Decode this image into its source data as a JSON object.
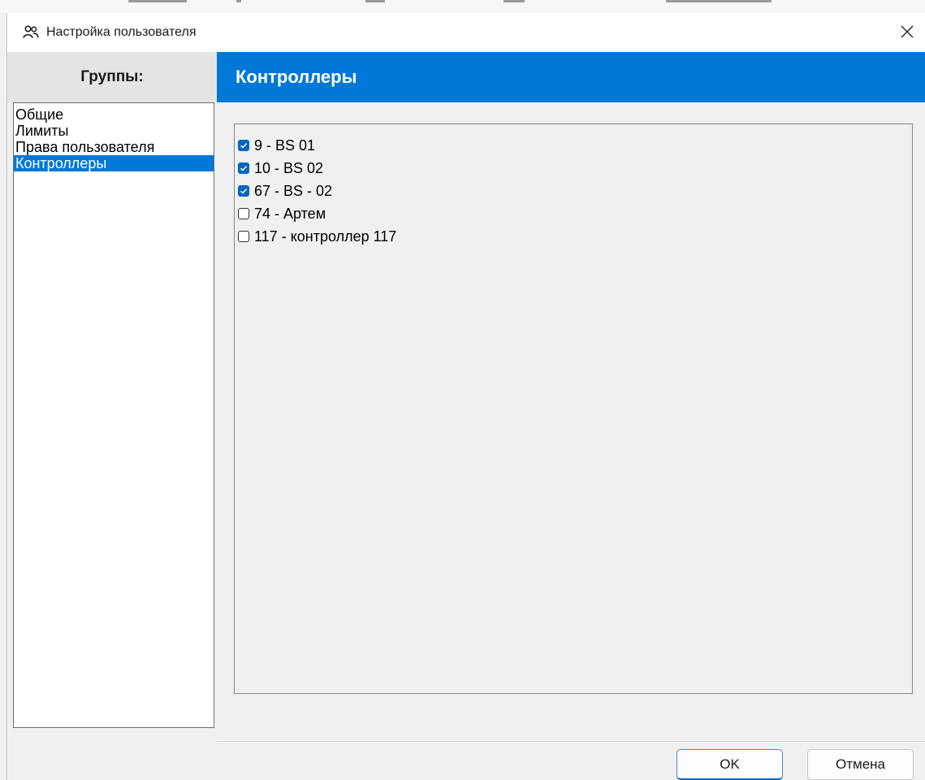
{
  "window": {
    "title": "Настройка пользователя",
    "title_icon": "users-icon",
    "close_icon": "close-icon"
  },
  "groups": {
    "header": "Группы:",
    "items": [
      {
        "label": "Общие",
        "selected": false
      },
      {
        "label": "Лимиты",
        "selected": false
      },
      {
        "label": "Права пользователя",
        "selected": false
      },
      {
        "label": "Контроллеры",
        "selected": true
      }
    ]
  },
  "section": {
    "title": "Контроллеры"
  },
  "controllers": [
    {
      "label": "9 - BS 01",
      "checked": true
    },
    {
      "label": "10 - BS 02",
      "checked": true
    },
    {
      "label": "67 - BS - 02",
      "checked": true
    },
    {
      "label": "74 - Артем",
      "checked": false
    },
    {
      "label": "117 - контроллер 117",
      "checked": false
    }
  ],
  "buttons": {
    "ok": "OK",
    "cancel": "Отмена"
  },
  "colors": {
    "accent": "#0078d7",
    "checkbox_checked": "#0067c0",
    "panel_bg": "#f0f0f0"
  }
}
